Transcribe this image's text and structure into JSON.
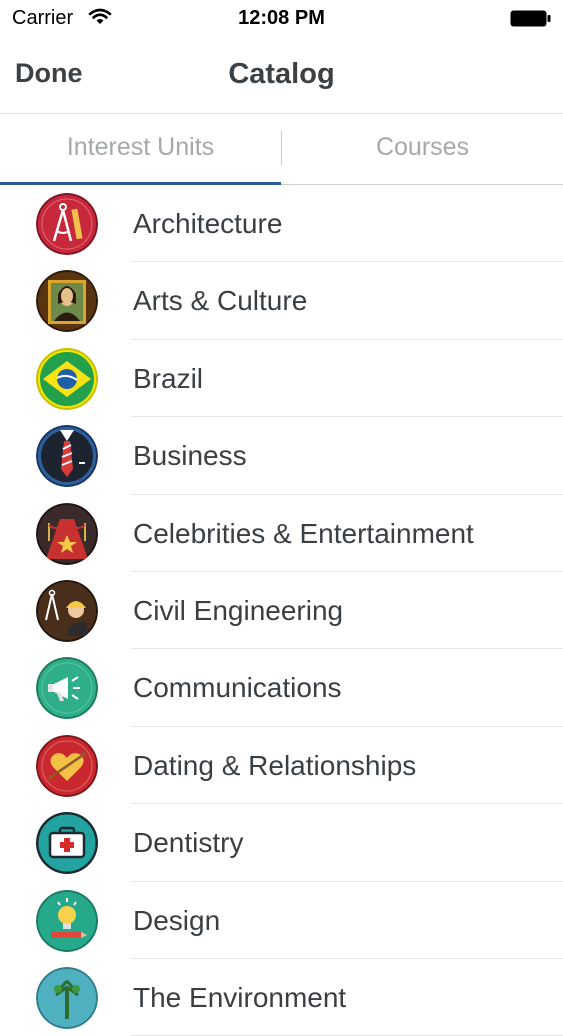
{
  "status_bar": {
    "carrier": "Carrier",
    "time": "12:08 PM"
  },
  "nav": {
    "done": "Done",
    "title": "Catalog"
  },
  "tabs": [
    {
      "label": "Interest Units",
      "selected": true
    },
    {
      "label": "Courses",
      "selected": false
    }
  ],
  "colors": {
    "accent": "#2c5a92",
    "tab_text": "#a3a9ad",
    "title_text": "#3c4145"
  },
  "items": [
    {
      "label": "Architecture",
      "icon": "architecture-compass-icon"
    },
    {
      "label": "Arts & Culture",
      "icon": "mona-lisa-icon"
    },
    {
      "label": "Brazil",
      "icon": "brazil-flag-icon"
    },
    {
      "label": "Business",
      "icon": "suit-tie-icon"
    },
    {
      "label": "Celebrities & Entertainment",
      "icon": "red-carpet-star-icon"
    },
    {
      "label": "Civil Engineering",
      "icon": "engineer-hardhat-icon"
    },
    {
      "label": "Communications",
      "icon": "megaphone-icon"
    },
    {
      "label": "Dating & Relationships",
      "icon": "heart-arrow-icon"
    },
    {
      "label": "Dentistry",
      "icon": "medical-kit-icon"
    },
    {
      "label": "Design",
      "icon": "lightbulb-pencil-icon"
    },
    {
      "label": "The Environment",
      "icon": "tree-icon"
    }
  ]
}
